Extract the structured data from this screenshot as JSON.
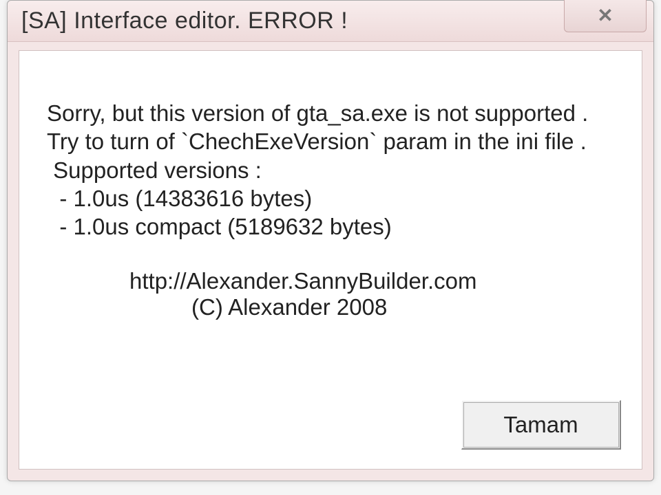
{
  "titlebar": {
    "title": "[SA] Interface editor. ERROR !",
    "close_label": "✕"
  },
  "message": {
    "line1": "Sorry, but this version of gta_sa.exe is not supported .",
    "line2": "Try to turn of `ChechExeVersion` param in the ini file .",
    "line3": " Supported versions :",
    "line4": "  - 1.0us (14383616 bytes)",
    "line5": "  - 1.0us compact (5189632 bytes)",
    "url": "http://Alexander.SannyBuilder.com",
    "copyright": "(C) Alexander 2008"
  },
  "buttons": {
    "ok_label": "Tamam"
  }
}
